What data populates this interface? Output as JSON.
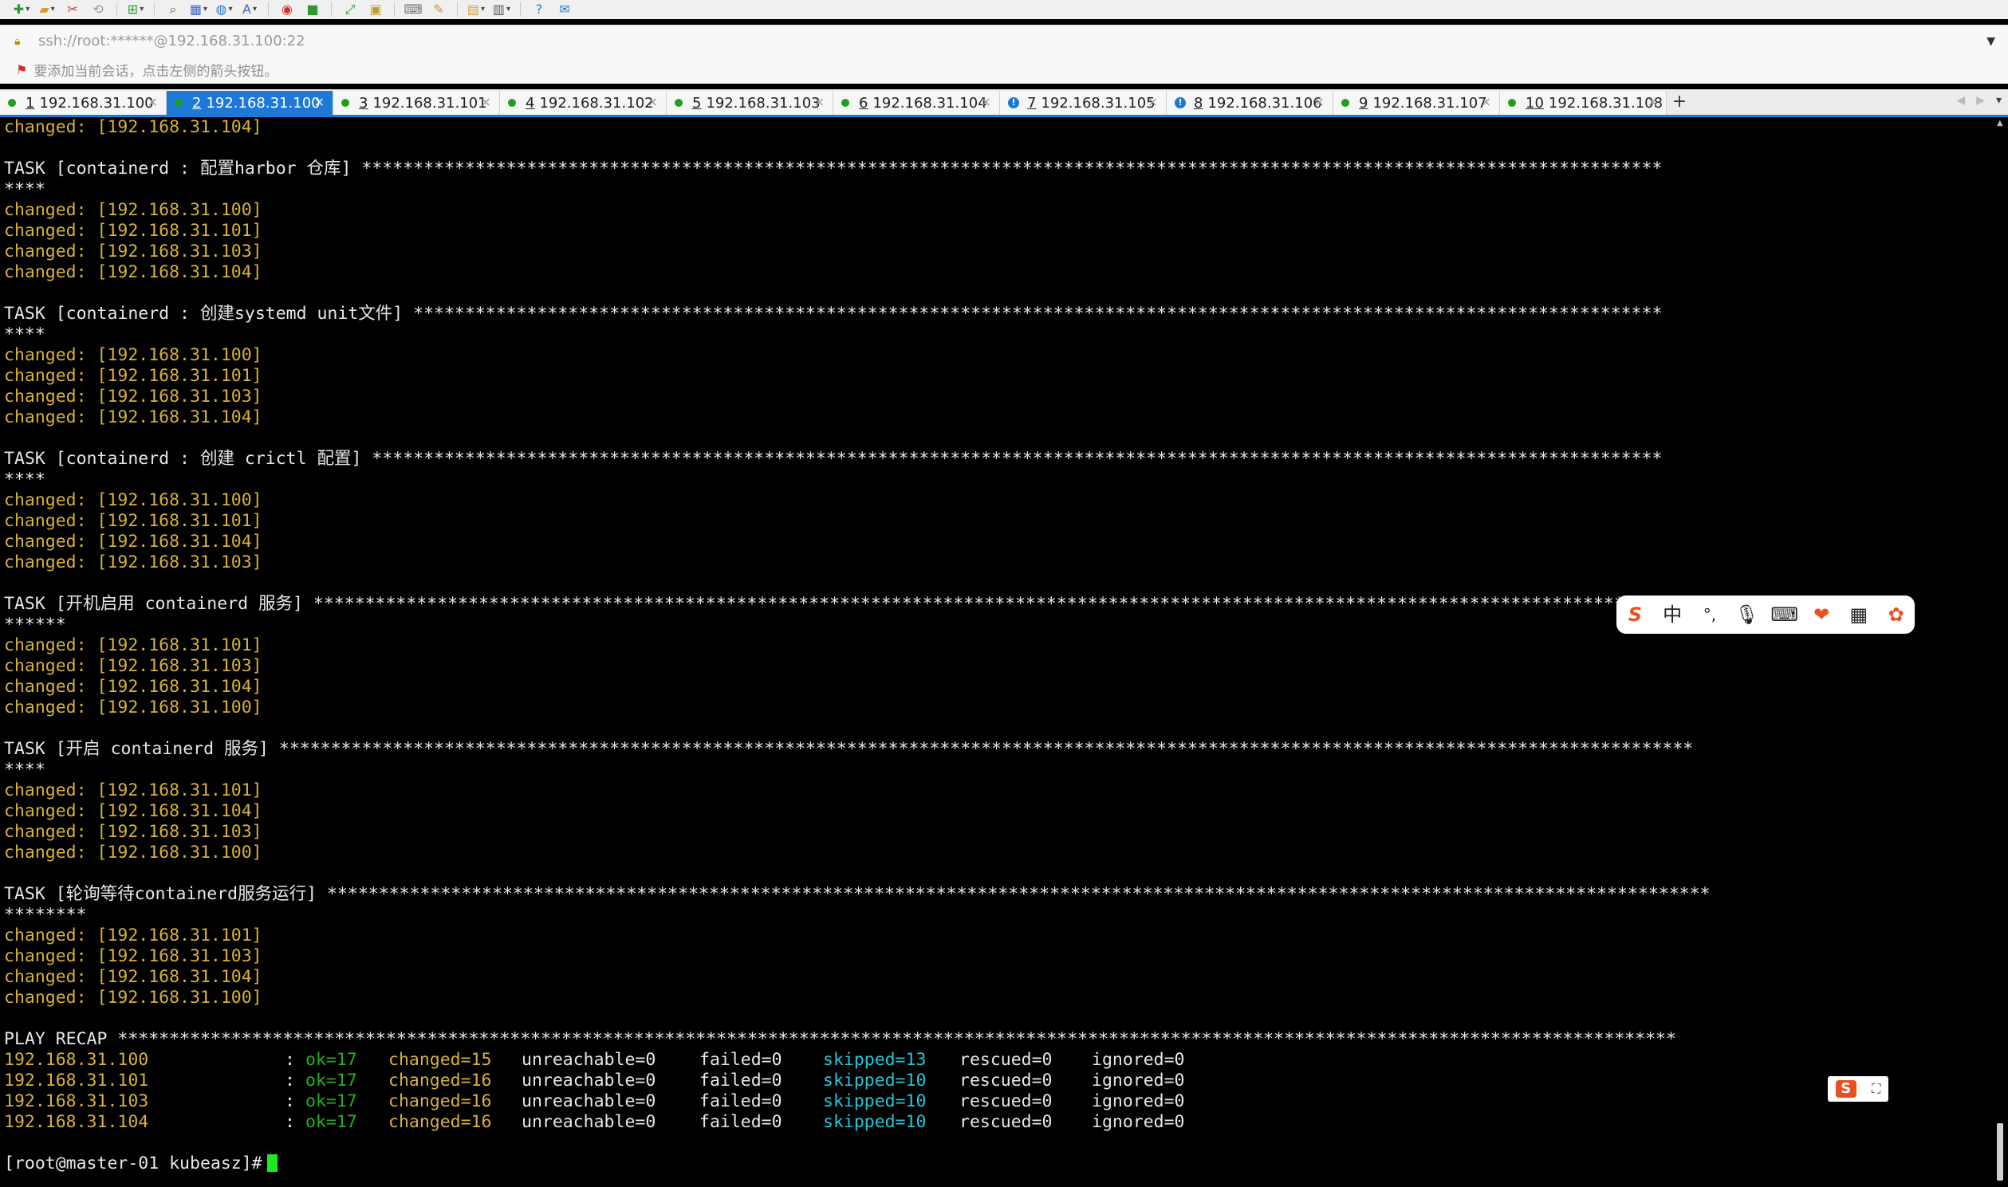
{
  "toolbar": {
    "icons": [
      "new-session-icon",
      "open-folder-icon",
      "disconnect-icon",
      "reconnect-icon",
      "new-tab-icon",
      "find-icon",
      "layout-icon",
      "globe-icon",
      "font-icon",
      "xftp-icon",
      "xshell-icon",
      "fullscreen-icon",
      "lock-icon",
      "keyboard-icon",
      "highlight-icon",
      "script-icon",
      "window-icon",
      "help-icon",
      "chat-icon"
    ]
  },
  "address": {
    "text": "ssh://root:******@192.168.31.100:22"
  },
  "hint": {
    "text": "要添加当前会话，点击左侧的箭头按钮。"
  },
  "tabs": [
    {
      "num": "1",
      "label": "192.168.31.100",
      "status": "green",
      "active": false
    },
    {
      "num": "2",
      "label": "192.168.31.100",
      "status": "green",
      "active": true
    },
    {
      "num": "3",
      "label": "192.168.31.101",
      "status": "green",
      "active": false
    },
    {
      "num": "4",
      "label": "192.168.31.102",
      "status": "green",
      "active": false
    },
    {
      "num": "5",
      "label": "192.168.31.103",
      "status": "green",
      "active": false
    },
    {
      "num": "6",
      "label": "192.168.31.104",
      "status": "green",
      "active": false
    },
    {
      "num": "7",
      "label": "192.168.31.105",
      "status": "warn",
      "active": false
    },
    {
      "num": "8",
      "label": "192.168.31.106",
      "status": "warn",
      "active": false
    },
    {
      "num": "9",
      "label": "192.168.31.107",
      "status": "green",
      "active": false
    },
    {
      "num": "10",
      "label": "192.168.31.108",
      "status": "green",
      "active": false
    }
  ],
  "colors": {
    "accent": "#1e78d7",
    "status_green": "#1ea01e",
    "changed": "#d8b236",
    "ok": "#22b022",
    "skipped": "#22c8d8",
    "cursor": "#1ee81e"
  },
  "terminal": {
    "lines": [
      {
        "text": "changed: [192.168.31.104]",
        "color": "y"
      },
      {
        "text": "",
        "color": "w"
      },
      {
        "text": "TASK [containerd : 配置harbor 仓库] ******************************************************************************************************************************",
        "color": "w"
      },
      {
        "text": "****",
        "color": "w"
      },
      {
        "text": "changed: [192.168.31.100]",
        "color": "y"
      },
      {
        "text": "changed: [192.168.31.101]",
        "color": "y"
      },
      {
        "text": "changed: [192.168.31.103]",
        "color": "y"
      },
      {
        "text": "changed: [192.168.31.104]",
        "color": "y"
      },
      {
        "text": "",
        "color": "w"
      },
      {
        "text": "TASK [containerd : 创建systemd unit文件] *************************************************************************************************************************",
        "color": "w"
      },
      {
        "text": "****",
        "color": "w"
      },
      {
        "text": "changed: [192.168.31.100]",
        "color": "y"
      },
      {
        "text": "changed: [192.168.31.101]",
        "color": "y"
      },
      {
        "text": "changed: [192.168.31.103]",
        "color": "y"
      },
      {
        "text": "changed: [192.168.31.104]",
        "color": "y"
      },
      {
        "text": "",
        "color": "w"
      },
      {
        "text": "TASK [containerd : 创建 crictl 配置] *****************************************************************************************************************************",
        "color": "w"
      },
      {
        "text": "****",
        "color": "w"
      },
      {
        "text": "changed: [192.168.31.100]",
        "color": "y"
      },
      {
        "text": "changed: [192.168.31.101]",
        "color": "y"
      },
      {
        "text": "changed: [192.168.31.104]",
        "color": "y"
      },
      {
        "text": "changed: [192.168.31.103]",
        "color": "y"
      },
      {
        "text": "",
        "color": "w"
      },
      {
        "text": "TASK [开机启用 containerd 服务] *************************************************************************************************************************************",
        "color": "w"
      },
      {
        "text": "******",
        "color": "w"
      },
      {
        "text": "changed: [192.168.31.101]",
        "color": "y"
      },
      {
        "text": "changed: [192.168.31.103]",
        "color": "y"
      },
      {
        "text": "changed: [192.168.31.104]",
        "color": "y"
      },
      {
        "text": "changed: [192.168.31.100]",
        "color": "y"
      },
      {
        "text": "",
        "color": "w"
      },
      {
        "text": "TASK [开启 containerd 服务] *****************************************************************************************************************************************",
        "color": "w"
      },
      {
        "text": "****",
        "color": "w"
      },
      {
        "text": "changed: [192.168.31.101]",
        "color": "y"
      },
      {
        "text": "changed: [192.168.31.104]",
        "color": "y"
      },
      {
        "text": "changed: [192.168.31.103]",
        "color": "y"
      },
      {
        "text": "changed: [192.168.31.100]",
        "color": "y"
      },
      {
        "text": "",
        "color": "w"
      },
      {
        "text": "TASK [轮询等待containerd服务运行] **************************************************************************************************************************************",
        "color": "w"
      },
      {
        "text": "********",
        "color": "w"
      },
      {
        "text": "changed: [192.168.31.101]",
        "color": "y"
      },
      {
        "text": "changed: [192.168.31.103]",
        "color": "y"
      },
      {
        "text": "changed: [192.168.31.104]",
        "color": "y"
      },
      {
        "text": "changed: [192.168.31.100]",
        "color": "y"
      },
      {
        "text": "",
        "color": "w"
      },
      {
        "text": "PLAY RECAP *******************************************************************************************************************************************************",
        "color": "w"
      }
    ],
    "recap": [
      {
        "host": "192.168.31.100",
        "sep": ":",
        "ok": "ok=17",
        "changed": "changed=15",
        "unreachable": "unreachable=0",
        "failed": "failed=0",
        "skipped": "skipped=13",
        "rescued": "rescued=0",
        "ignored": "ignored=0"
      },
      {
        "host": "192.168.31.101",
        "sep": ":",
        "ok": "ok=17",
        "changed": "changed=16",
        "unreachable": "unreachable=0",
        "failed": "failed=0",
        "skipped": "skipped=10",
        "rescued": "rescued=0",
        "ignored": "ignored=0"
      },
      {
        "host": "192.168.31.103",
        "sep": ":",
        "ok": "ok=17",
        "changed": "changed=16",
        "unreachable": "unreachable=0",
        "failed": "failed=0",
        "skipped": "skipped=10",
        "rescued": "rescued=0",
        "ignored": "ignored=0"
      },
      {
        "host": "192.168.31.104",
        "sep": ":",
        "ok": "ok=17",
        "changed": "changed=16",
        "unreachable": "unreachable=0",
        "failed": "failed=0",
        "skipped": "skipped=10",
        "rescued": "rescued=0",
        "ignored": "ignored=0"
      }
    ],
    "prompt": "[root@master-01 kubeasz]#"
  },
  "ime": {
    "lang": "中",
    "punct": "°,"
  }
}
